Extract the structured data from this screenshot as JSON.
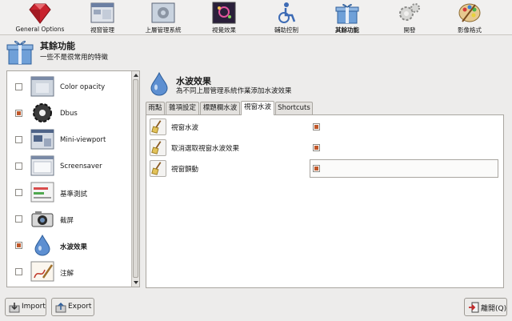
{
  "toolbar": {
    "categories": [
      {
        "label": "General Options",
        "icon": "ruby-gem-icon"
      },
      {
        "label": "視窗管理",
        "icon": "window-management-icon"
      },
      {
        "label": "上層管理系統",
        "icon": "desktop-gears-icon"
      },
      {
        "label": "視覺效果",
        "icon": "fireworks-icon"
      },
      {
        "label": "輔助控制",
        "icon": "wheelchair-icon"
      },
      {
        "label": "其餘功能",
        "icon": "gift-box-icon"
      },
      {
        "label": "開發",
        "icon": "gears-icon"
      },
      {
        "label": "影像格式",
        "icon": "palette-icon"
      }
    ],
    "active_index": 5
  },
  "header": {
    "title": "其餘功能",
    "subtitle": "一些不是很常用的特徵"
  },
  "plugins": [
    {
      "label": "Color opacity",
      "checked": false,
      "icon": "color-opacity-icon"
    },
    {
      "label": "Dbus",
      "checked": true,
      "icon": "dbus-gear-icon"
    },
    {
      "label": "Mini-viewport",
      "checked": false,
      "icon": "mini-viewport-icon"
    },
    {
      "label": "Screensaver",
      "checked": false,
      "icon": "screensaver-icon"
    },
    {
      "label": "基準測試",
      "checked": false,
      "icon": "benchmark-icon"
    },
    {
      "label": "截屏",
      "checked": false,
      "icon": "camera-icon"
    },
    {
      "label": "水波效果",
      "checked": true,
      "bold": true,
      "icon": "water-drop-icon"
    },
    {
      "label": "注解",
      "checked": false,
      "icon": "annotate-icon"
    }
  ],
  "panel": {
    "title": "水波效果",
    "subtitle": "為不同上層管理系統作業添加水波效果",
    "tabs": [
      "雨點",
      "雜項設定",
      "標題欄水波",
      "視窗水波",
      "Shortcuts"
    ],
    "active_tab": 3,
    "options": [
      {
        "label": "視窗水波",
        "checked": true
      },
      {
        "label": "取消選取視窗水波效果",
        "checked": true
      },
      {
        "label": "視窗顫動",
        "checked": true
      }
    ]
  },
  "buttons": {
    "import": "Import",
    "export": "Export",
    "close": "離開(Q)"
  },
  "colors": {
    "check": "#c0582a",
    "background": "#edeceb"
  }
}
